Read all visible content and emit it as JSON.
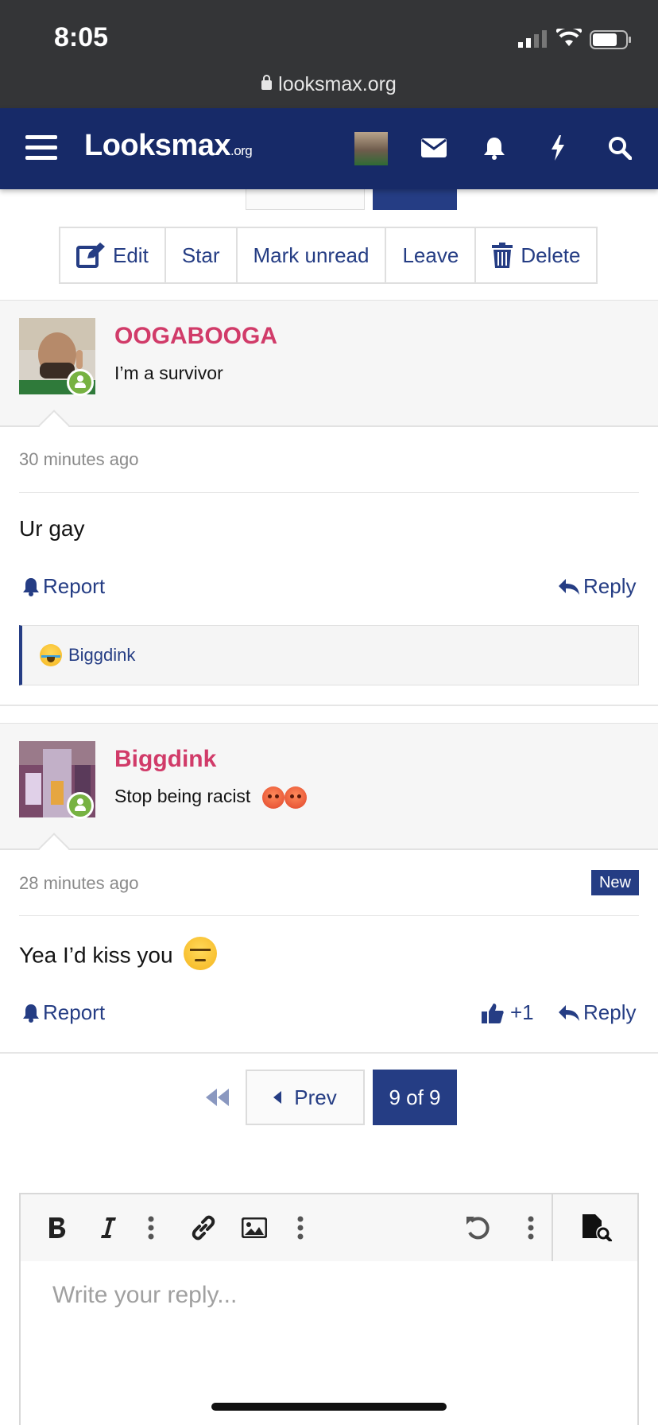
{
  "status_bar": {
    "time": "8:05",
    "url": "looksmax.org"
  },
  "navbar": {
    "logo": "Looksmax",
    "logo_suffix": ".org",
    "icons": [
      "menu-icon",
      "avatar",
      "mail-icon",
      "bell-icon",
      "bolt-icon",
      "search-icon"
    ]
  },
  "actions": {
    "edit": "Edit",
    "star": "Star",
    "mark_unread": "Mark unread",
    "leave": "Leave",
    "delete": "Delete"
  },
  "messages": [
    {
      "username": "OOGABOOGA",
      "user_title": "I’m a survivor",
      "time": "30 minutes ago",
      "body": "Ur gay",
      "report": "Report",
      "reply": "Reply",
      "reaction_user": "Biggdink"
    },
    {
      "username": "Biggdink",
      "user_title": "Stop being racist",
      "time": "28 minutes ago",
      "badge": "New",
      "body": "Yea I’d kiss you",
      "report": "Report",
      "like_count": "+1",
      "reply": "Reply"
    }
  ],
  "pagination": {
    "prev": "Prev",
    "current": "9 of 9"
  },
  "editor": {
    "placeholder": "Write your reply..."
  },
  "colors": {
    "navy": "#172a68",
    "accent": "#253d84",
    "username": "#d13b69",
    "online": "#77b242"
  }
}
